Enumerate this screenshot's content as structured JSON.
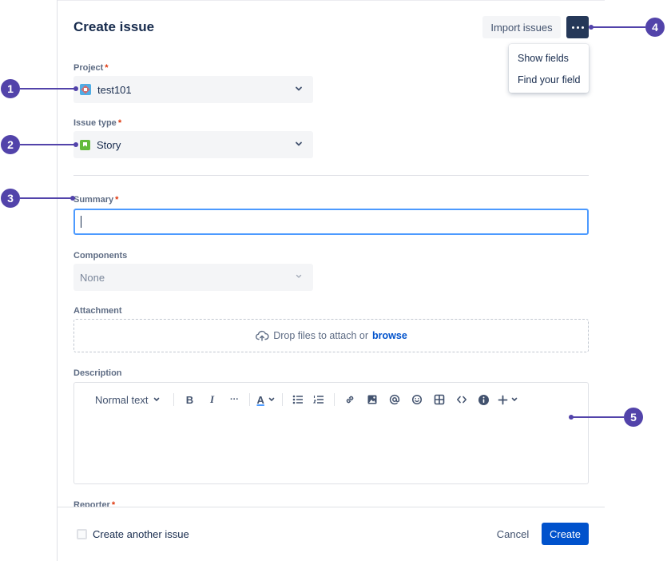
{
  "dialog": {
    "title": "Create issue",
    "import_label": "Import issues",
    "more_menu": [
      "Show fields",
      "Find your field"
    ]
  },
  "fields": {
    "project": {
      "label": "Project",
      "required_mark": "*",
      "value": "test101"
    },
    "issue_type": {
      "label": "Issue type",
      "required_mark": "*",
      "value": "Story"
    },
    "summary": {
      "label": "Summary",
      "required_mark": "*",
      "value": ""
    },
    "components": {
      "label": "Components",
      "value": "None"
    },
    "attachment": {
      "label": "Attachment",
      "drop_text": "Drop files to attach or",
      "browse_label": "browse"
    },
    "description": {
      "label": "Description",
      "text_style": "Normal text"
    },
    "reporter": {
      "label": "Reporter",
      "required_mark": "*"
    }
  },
  "toolbar": {
    "bold": "B",
    "italic": "I",
    "more": "···",
    "text_color": "A",
    "items": [
      "bullet-list",
      "numbered-list",
      "link",
      "image",
      "mention",
      "emoji",
      "table",
      "code",
      "info",
      "insert"
    ]
  },
  "footer": {
    "create_another_label": "Create another issue",
    "create_another_checked": false,
    "cancel_label": "Cancel",
    "create_label": "Create"
  },
  "callouts": [
    "1",
    "2",
    "3",
    "4",
    "5"
  ],
  "colors": {
    "primary": "#0052cc",
    "callout": "#5243aa",
    "required": "#de350b",
    "focus": "#4c9aff",
    "more_button": "#253858"
  }
}
